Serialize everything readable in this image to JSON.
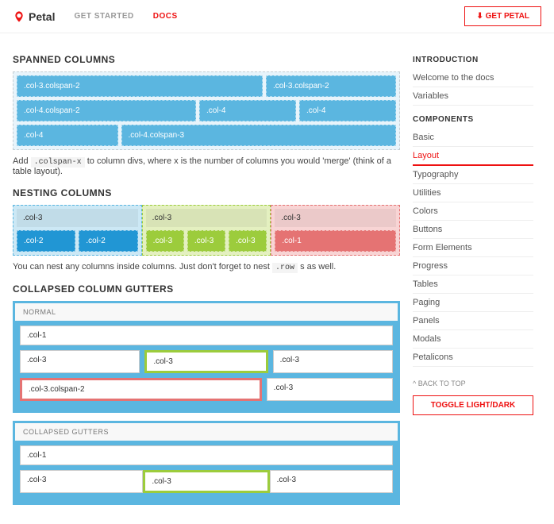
{
  "brand": {
    "name": "Petal"
  },
  "nav": {
    "get_started": "GET STARTED",
    "docs": "DOCS",
    "get_btn": "GET PETAL"
  },
  "sidebar": {
    "intro_head": "INTRODUCTION",
    "intro_items": [
      "Welcome to the docs",
      "Variables"
    ],
    "comp_head": "COMPONENTS",
    "comp_items": [
      "Basic",
      "Layout",
      "Typography",
      "Utilities",
      "Colors",
      "Buttons",
      "Form Elements",
      "Progress",
      "Tables",
      "Paging",
      "Panels",
      "Modals",
      "Petalicons"
    ],
    "comp_active_index": 1,
    "back_top": "BACK TO TOP",
    "toggle": "TOGGLE LIGHT/DARK"
  },
  "spanned": {
    "title": "SPANNED COLUMNS",
    "rows": [
      [
        {
          "label": ".col-3.colspan-2",
          "flex": 2
        },
        {
          "label": ".col-3.colspan-2",
          "flex": 1
        }
      ],
      [
        {
          "label": ".col-4.colspan-2",
          "flex": 2
        },
        {
          "label": ".col-4",
          "flex": 1
        },
        {
          "label": ".col-4",
          "flex": 1
        }
      ],
      [
        {
          "label": ".col-4",
          "flex": 1
        },
        {
          "label": ".col-4.colspan-3",
          "flex": 3
        }
      ]
    ],
    "desc_pre": "Add ",
    "desc_code": ".colspan-x",
    "desc_post": " to column divs, where x is the number of columns you would 'merge' (think of a table layout)."
  },
  "nesting": {
    "title": "NESTING COLUMNS",
    "cols": [
      {
        "head": ".col-3",
        "cells": [
          {
            "label": ".col-2",
            "flex": 1
          },
          {
            "label": ".col-2",
            "flex": 1
          }
        ],
        "theme": "b",
        "cell_theme": "blue2"
      },
      {
        "head": ".col-3",
        "cells": [
          {
            "label": ".col-3",
            "flex": 1
          },
          {
            "label": ".col-3",
            "flex": 1
          },
          {
            "label": ".col-3",
            "flex": 1
          }
        ],
        "theme": "g",
        "cell_theme": "green"
      },
      {
        "head": ".col-3",
        "cells": [
          {
            "label": ".col-1",
            "flex": 1
          }
        ],
        "theme": "r",
        "cell_theme": "red"
      }
    ],
    "desc_pre": "You can nest any columns inside columns. Just don't forget to nest ",
    "desc_code": ".row",
    "desc_post": " s as well."
  },
  "collapsed": {
    "title": "COLLAPSED COLUMN GUTTERS",
    "sections": [
      {
        "label": "NORMAL",
        "rows": [
          [
            {
              "label": ".col-1",
              "flex": 1
            }
          ],
          [
            {
              "label": ".col-3",
              "flex": 1
            },
            {
              "label": ".col-3",
              "flex": 1,
              "border": "gborder"
            },
            {
              "label": ".col-3",
              "flex": 1
            }
          ],
          [
            {
              "label": ".col-3.colspan-2",
              "flex": 2,
              "border": "rborder"
            },
            {
              "label": ".col-3",
              "flex": 1
            }
          ]
        ],
        "gap": true
      },
      {
        "label": "COLLAPSED GUTTERS",
        "rows": [
          [
            {
              "label": ".col-1",
              "flex": 1
            }
          ],
          [
            {
              "label": ".col-3",
              "flex": 1
            },
            {
              "label": ".col-3",
              "flex": 1,
              "border": "gborder"
            },
            {
              "label": ".col-3",
              "flex": 1
            }
          ]
        ],
        "gap": false
      }
    ]
  }
}
